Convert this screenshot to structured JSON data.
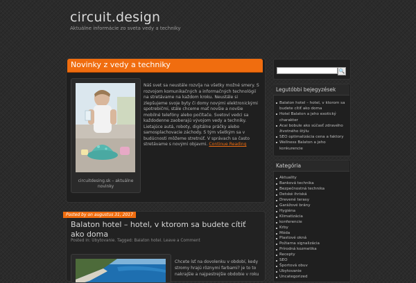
{
  "site": {
    "title": "circuit.design",
    "tagline": "Aktuálne informácie zo sveta vedy a techniky"
  },
  "featured": {
    "heading": "Novinky z vedy a techniky",
    "image_caption": "circuitdesing.sk – aktuálne novinky",
    "excerpt": "Náš svet sa neustále rozvíja na všetky možné smery. S rozvojom komunikačných a informačných technológií na stretávame na každom kroku. Neustále si zlepšujeme svoje byty či domy novými elektronickými spotrebičmi, stále chceme mať novšie a novšie mobilné telefóny alebo počítače. Svetoví vedci sa každodenne zaoberajú vývojom vedy a techniky. Lietajúce autá, roboty, digitálne práčky alebo samosplachovacie záchody. S tým všetkým sa v budúcnosti môžeme stretnúť. V správach sa často stretávame s novými objavmi.",
    "read_more": "Continue Reading"
  },
  "post": {
    "date_badge": "Posted by on augustus 31, 2017",
    "title": "Balaton hotel – hotel, v ktorom sa budete cítiť ako doma",
    "meta": "Posted in: Ubytovanie. Tagged: Balaton hotel. Leave a Comment",
    "excerpt": "Chcete ísť na dovolenku v období, kedy stromy hrajú rôznymi farbami? je to to nakrajšie a najpestrejšie obdobie v roku"
  },
  "sidebar": {
    "search_button": "🔍",
    "recent_title": "Legutóbbi bejegyzések",
    "recent": [
      "Balaton hotel – hotel, v ktorom sa budete cítiť ako doma",
      "Hotel Balaton a jeho exotický charakter",
      "Acai bobule ako súčasť zdravého životného štýlu",
      "SEO optimalizácia cena a faktory",
      "Wellness Balaton a jeho konkurencie"
    ],
    "categories_title": "Kategória",
    "categories": [
      "Aktuality",
      "Banková technika",
      "Bezpečnostná technika",
      "Detské ihriská",
      "Drevené terasy",
      "Garážové brány",
      "Hygiéna",
      "Klimatizácia",
      "konferencie",
      "Krby",
      "Móda",
      "Plastové okná",
      "Požiarna signalizácia",
      "Prírodná kozmetika",
      "Recepty",
      "SEO",
      "Športová obuv",
      "Ubytovanie",
      "Uncategorized"
    ]
  },
  "colors": {
    "accent": "#f06d0f",
    "background": "#2b2b2b",
    "panel": "#1f1f1f"
  }
}
